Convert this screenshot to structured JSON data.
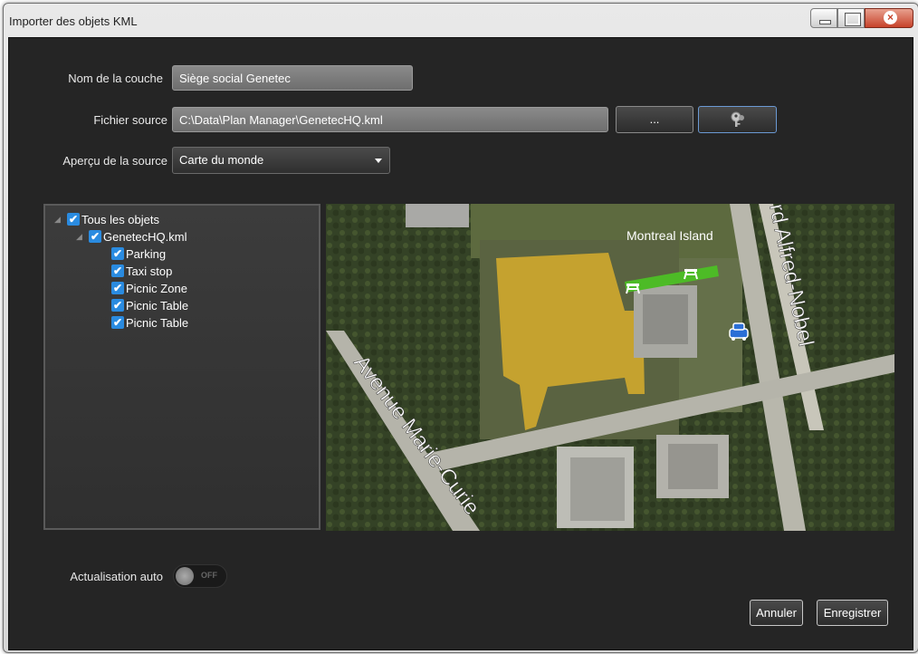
{
  "window": {
    "title": "Importer des objets KML",
    "controls": {
      "minimize": "minimize-icon",
      "maximize": "maximize-icon",
      "close": "close-icon"
    }
  },
  "form": {
    "layer_name_label": "Nom de la couche",
    "layer_name_value": "Siège social Genetec",
    "source_file_label": "Fichier source",
    "source_file_value": "C:\\Data\\Plan Manager\\GenetecHQ.kml",
    "browse_label": "...",
    "key_icon": "key-icon",
    "preview_label": "Aperçu de la source",
    "preview_value": "Carte du monde"
  },
  "tree": {
    "root": "Tous les objets",
    "file": "GenetecHQ.kml",
    "items": [
      "Parking",
      "Taxi stop",
      "Picnic Zone",
      "Picnic Table",
      "Picnic Table"
    ]
  },
  "map": {
    "labels": [
      "Montreal Island",
      "rd Alfred-Nobel",
      "Avenue Marie-Curie"
    ],
    "colors": {
      "parking": "#e3b32a",
      "picnic_zone": "#4dbb26",
      "taxi": "#2b6fd6"
    }
  },
  "bottom": {
    "auto_refresh_label": "Actualisation auto",
    "toggle_state": "OFF",
    "cancel_label": "Annuler",
    "save_label": "Enregistrer"
  }
}
